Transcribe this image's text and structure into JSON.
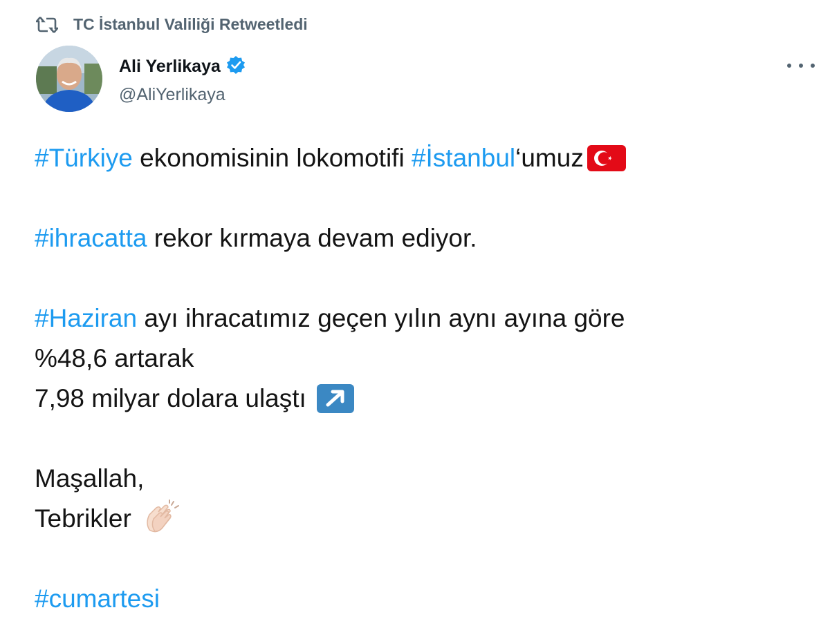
{
  "retweet": {
    "icon": "retweet-icon",
    "label": "TC İstanbul Valiliği Retweetledi"
  },
  "author": {
    "display_name": "Ali Yerlikaya",
    "handle": "@AliYerlikaya",
    "verified_icon": "verified-badge-icon"
  },
  "menu": {
    "icon": "more-options-icon"
  },
  "colors": {
    "hashtag": "#1d9bf0",
    "secondary_text": "#536471",
    "verified": "#1d9bf0"
  },
  "tweet": {
    "line1": {
      "tag1": "#Türkiye",
      "text1": " ekonomisinin lokomotifi ",
      "tag2": "#İstanbul",
      "text2": "‘umuz",
      "emoji": "turkey-flag-icon"
    },
    "line2": {
      "tag": "#ihracatta",
      "text": " rekor kırmaya devam ediyor."
    },
    "line3": {
      "tag": "#Haziran",
      "text": " ayı ihracatımız geçen yılın aynı ayına göre"
    },
    "line4": {
      "text": "%48,6 artarak"
    },
    "line5": {
      "text": "7,98 milyar dolara ulaştı ",
      "emoji": "up-right-arrow-icon"
    },
    "line6": {
      "text": "Maşallah,"
    },
    "line7": {
      "text": "Tebrikler ",
      "emoji": "clapping-hands-icon"
    },
    "line8": {
      "tag": "#cumartesi"
    }
  }
}
